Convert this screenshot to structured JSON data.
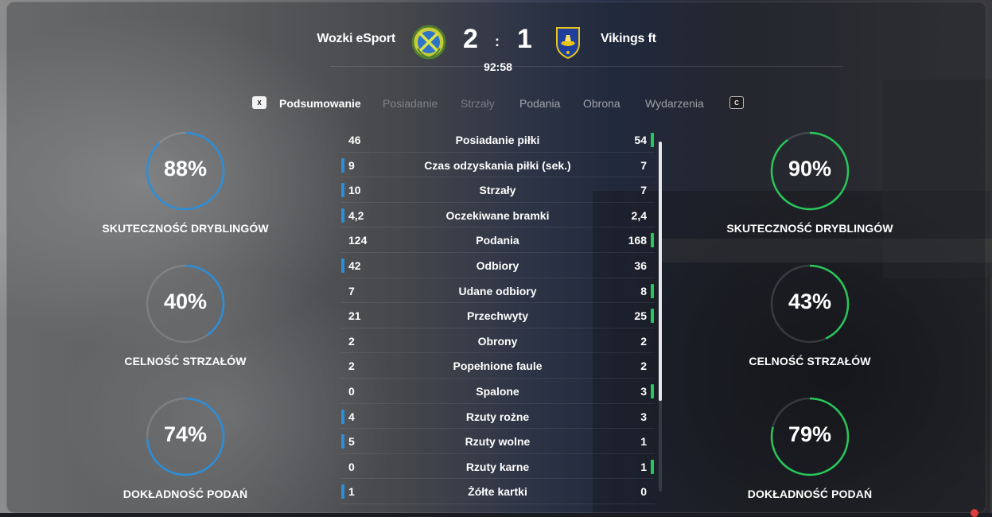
{
  "match": {
    "home": {
      "name": "Wozki eSport",
      "score": "2",
      "crest_icon": "crossed-sticks-shield-icon",
      "color": "#2b8ed9"
    },
    "away": {
      "name": "Vikings ft",
      "score": "1",
      "crest_icon": "viking-ship-shield-icon",
      "color": "#27c75a"
    },
    "separator": ":",
    "clock": "92:58"
  },
  "tabs": {
    "prev_key": "X",
    "next_key": "C",
    "items": [
      {
        "label": "Podsumowanie",
        "state": "active"
      },
      {
        "label": "Posiadanie",
        "state": "faded"
      },
      {
        "label": "Strzały",
        "state": "faded"
      },
      {
        "label": "Podania",
        "state": "normal"
      },
      {
        "label": "Obrona",
        "state": "normal"
      },
      {
        "label": "Wydarzenia",
        "state": "normal"
      }
    ]
  },
  "home_rings": [
    {
      "value": "88%",
      "fraction": 0.88,
      "label": "SKUTECZNOŚĆ DRYBLINGÓW"
    },
    {
      "value": "40%",
      "fraction": 0.4,
      "label": "CELNOŚĆ STRZAŁÓW"
    },
    {
      "value": "74%",
      "fraction": 0.74,
      "label": "DOKŁADNOŚĆ PODAŃ"
    }
  ],
  "away_rings": [
    {
      "value": "90%",
      "fraction": 0.9,
      "label": "SKUTECZNOŚĆ DRYBLINGÓW"
    },
    {
      "value": "43%",
      "fraction": 0.43,
      "label": "CELNOŚĆ STRZAŁÓW"
    },
    {
      "value": "79%",
      "fraction": 0.79,
      "label": "DOKŁADNOŚĆ PODAŃ"
    }
  ],
  "stats": [
    {
      "name": "Posiadanie piłki",
      "home": "46",
      "away": "54",
      "lead": "away"
    },
    {
      "name": "Czas odzyskania piłki (sek.)",
      "home": "9",
      "away": "7",
      "lead": "home"
    },
    {
      "name": "Strzały",
      "home": "10",
      "away": "7",
      "lead": "home"
    },
    {
      "name": "Oczekiwane bramki",
      "home": "4,2",
      "away": "2,4",
      "lead": "home"
    },
    {
      "name": "Podania",
      "home": "124",
      "away": "168",
      "lead": "away"
    },
    {
      "name": "Odbiory",
      "home": "42",
      "away": "36",
      "lead": "home"
    },
    {
      "name": "Udane odbiory",
      "home": "7",
      "away": "8",
      "lead": "away"
    },
    {
      "name": "Przechwyty",
      "home": "21",
      "away": "25",
      "lead": "away"
    },
    {
      "name": "Obrony",
      "home": "2",
      "away": "2",
      "lead": "none"
    },
    {
      "name": "Popełnione faule",
      "home": "2",
      "away": "2",
      "lead": "none"
    },
    {
      "name": "Spalone",
      "home": "0",
      "away": "3",
      "lead": "away"
    },
    {
      "name": "Rzuty rożne",
      "home": "4",
      "away": "3",
      "lead": "home"
    },
    {
      "name": "Rzuty wolne",
      "home": "5",
      "away": "1",
      "lead": "home"
    },
    {
      "name": "Rzuty karne",
      "home": "0",
      "away": "1",
      "lead": "away"
    },
    {
      "name": "Żółte kartki",
      "home": "1",
      "away": "0",
      "lead": "home"
    }
  ]
}
